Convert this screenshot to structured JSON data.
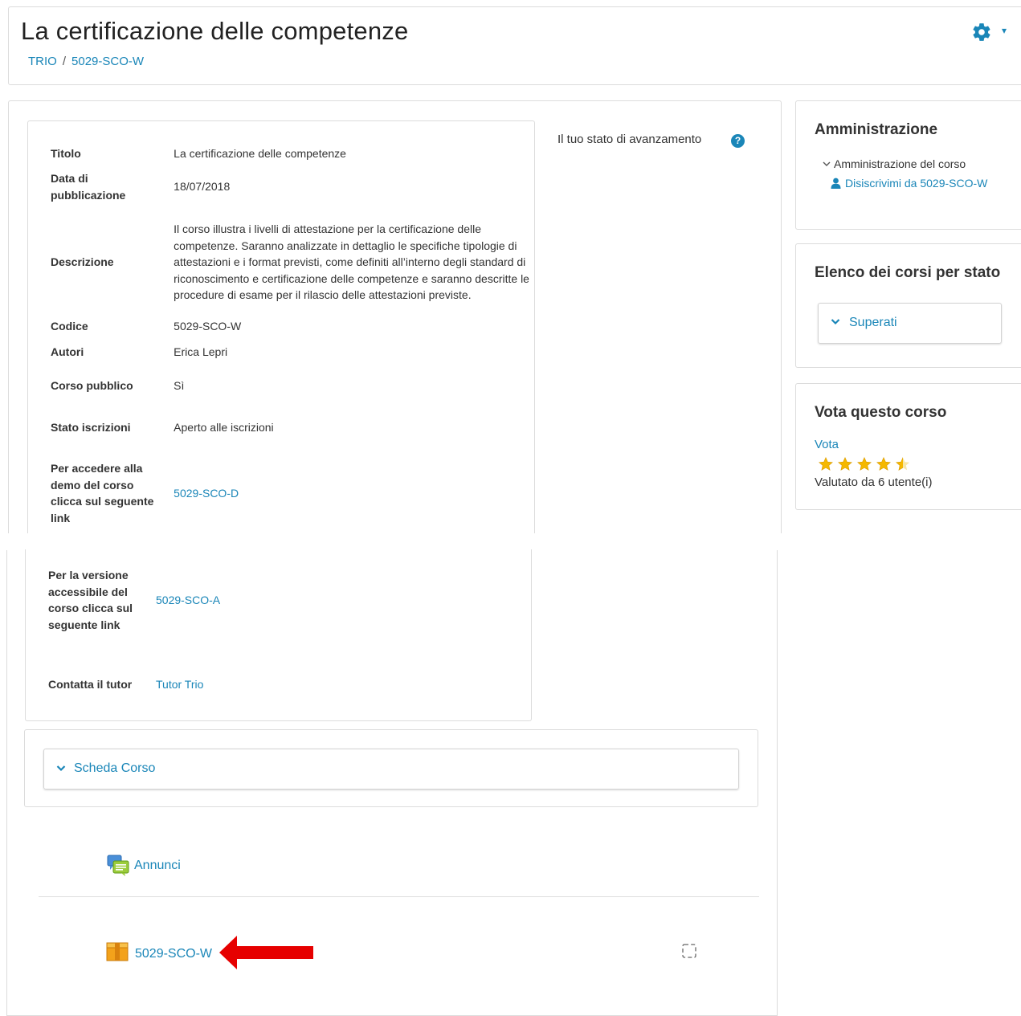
{
  "header": {
    "title": "La certificazione delle competenze",
    "breadcrumb": [
      "TRIO",
      "5029-SCO-W"
    ],
    "breadcrumb_separator": "/"
  },
  "course_info": {
    "rows": [
      {
        "label": "Titolo",
        "value": "La certificazione delle competenze"
      },
      {
        "label": "Data di pubblicazione",
        "value": "18/07/2018"
      },
      {
        "label": "Descrizione",
        "value": "Il corso illustra i livelli di attestazione per la certificazione delle competenze. Saranno analizzate in dettaglio le specifiche tipologie di attestazioni e i format previsti, come definiti all’interno degli standard di riconoscimento e certificazione delle competenze e saranno descritte le procedure di esame per il rilascio delle attestazioni previste."
      },
      {
        "label": "Codice",
        "value": "5029-SCO-W"
      },
      {
        "label": "Autori",
        "value": "Erica Lepri"
      },
      {
        "label": "Corso pubblico",
        "value": "Sì"
      },
      {
        "label": "Stato iscrizioni",
        "value": "Aperto alle iscrizioni"
      },
      {
        "label": "Per accedere alla demo del corso clicca sul seguente link",
        "value": "5029-SCO-D"
      },
      {
        "label": "Per la versione accessibile del corso clicca sul seguente link",
        "value": "5029-SCO-A"
      },
      {
        "label": "Contatta il tutor",
        "value": "Tutor Trio"
      }
    ]
  },
  "progress": {
    "label": "Il tuo stato di avanzamento",
    "help_icon": "question-circle-icon"
  },
  "admin_block": {
    "title": "Amministrazione",
    "node": "Amministrazione del corso",
    "unenrol": "Disiscrivimi da 5029-SCO-W"
  },
  "state_block": {
    "title": "Elenco dei corsi per stato",
    "section": "Superati"
  },
  "vote_block": {
    "title": "Vota questo corso",
    "vote_label": "Vota",
    "rating": 4.5,
    "max_rating": 5,
    "rated_by": "Valutato da 6 utente(i)"
  },
  "scheda": {
    "label": "Scheda Corso"
  },
  "activities": [
    {
      "name": "Annunci",
      "icon": "forum-icon"
    },
    {
      "name": "5029-SCO-W",
      "icon": "scorm-package-icon"
    }
  ],
  "colors": {
    "link": "#1a86b8",
    "arrow": "#e60000",
    "star": "#f5b800"
  }
}
